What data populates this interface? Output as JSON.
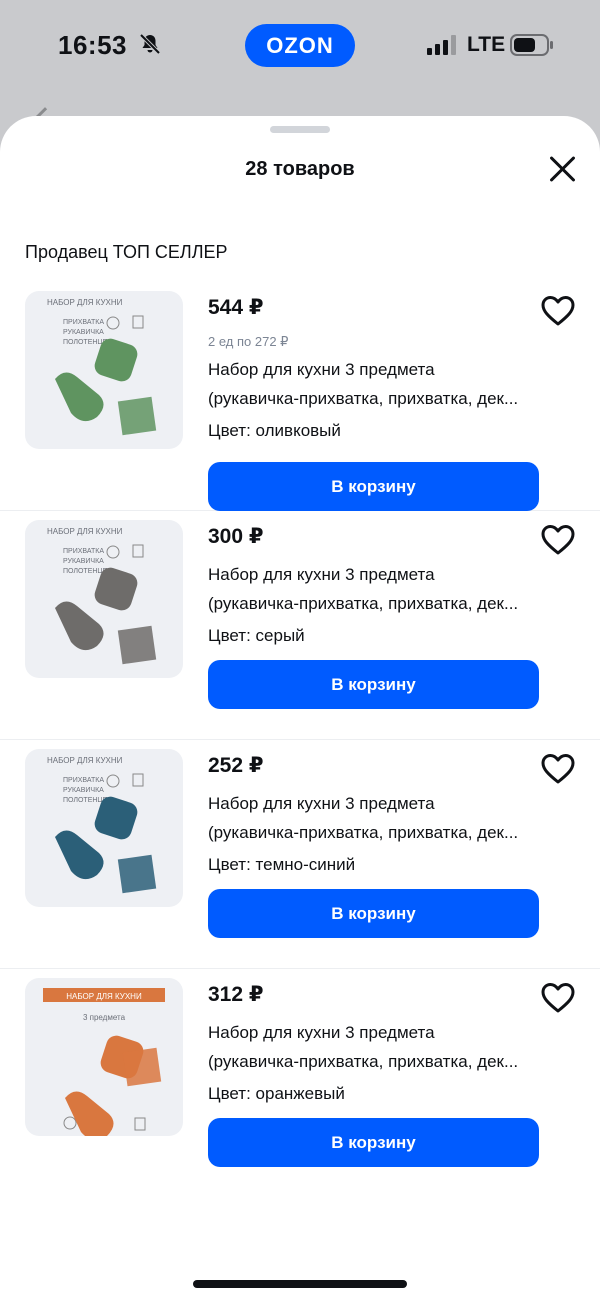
{
  "status_bar": {
    "time": "16:53",
    "bell_icon": "bell-slash-icon",
    "app_badge": "OZON",
    "network": "LTE",
    "signal_icon": "cellular-signal-icon",
    "battery_icon": "battery-icon"
  },
  "sheet": {
    "title": "28 товаров",
    "close_icon": "close-icon",
    "seller": "Продавец ТОП СЕЛЛЕР"
  },
  "colors": {
    "accent": "#005bff",
    "text": "#0f1115",
    "muted": "#7c8594",
    "thumb_bg": "#eef0f4"
  },
  "products": [
    {
      "price": "544 ₽",
      "unit_price": "2 ед по 272 ₽",
      "title_line1": "Набор для кухни 3 предмета",
      "title_line2": "(рукавичка-прихватка, прихватка, дек...",
      "color": "Цвет: оливковый",
      "cart_label": "В корзину",
      "item_color": "#5f9460",
      "image_heading": "НАБОР ДЛЯ КУХНИ",
      "image_lines": [
        "ПРИХВАТКА",
        "РУКАВИЧКА",
        "ПОЛОТЕНЦЕ"
      ]
    },
    {
      "price": "300 ₽",
      "title_line1": "Набор для кухни 3 предмета",
      "title_line2": "(рукавичка-прихватка, прихватка, дек...",
      "color": "Цвет: серый",
      "cart_label": "В корзину",
      "item_color": "#6e6c6a",
      "image_heading": "НАБОР ДЛЯ КУХНИ",
      "image_lines": [
        "ПРИХВАТКА",
        "РУКАВИЧКА",
        "ПОЛОТЕНЦЕ"
      ]
    },
    {
      "price": "252 ₽",
      "title_line1": "Набор для кухни 3 предмета",
      "title_line2": "(рукавичка-прихватка, прихватка, дек...",
      "color": "Цвет: темно-синий",
      "cart_label": "В корзину",
      "item_color": "#2b5f78",
      "image_heading": "НАБОР ДЛЯ КУХНИ",
      "image_lines": [
        "ПРИХВАТКА",
        "РУКАВИЧКА",
        "ПОЛОТЕНЦЕ"
      ]
    },
    {
      "price": "312 ₽",
      "title_line1": "Набор для кухни 3 предмета",
      "title_line2": "(рукавичка-прихватка, прихватка, дек...",
      "color": "Цвет: оранжевый",
      "cart_label": "В корзину",
      "item_color": "#d9773f",
      "image_heading": "НАБОР ДЛЯ КУХНИ",
      "image_lines": [
        "3 предмета"
      ]
    }
  ]
}
